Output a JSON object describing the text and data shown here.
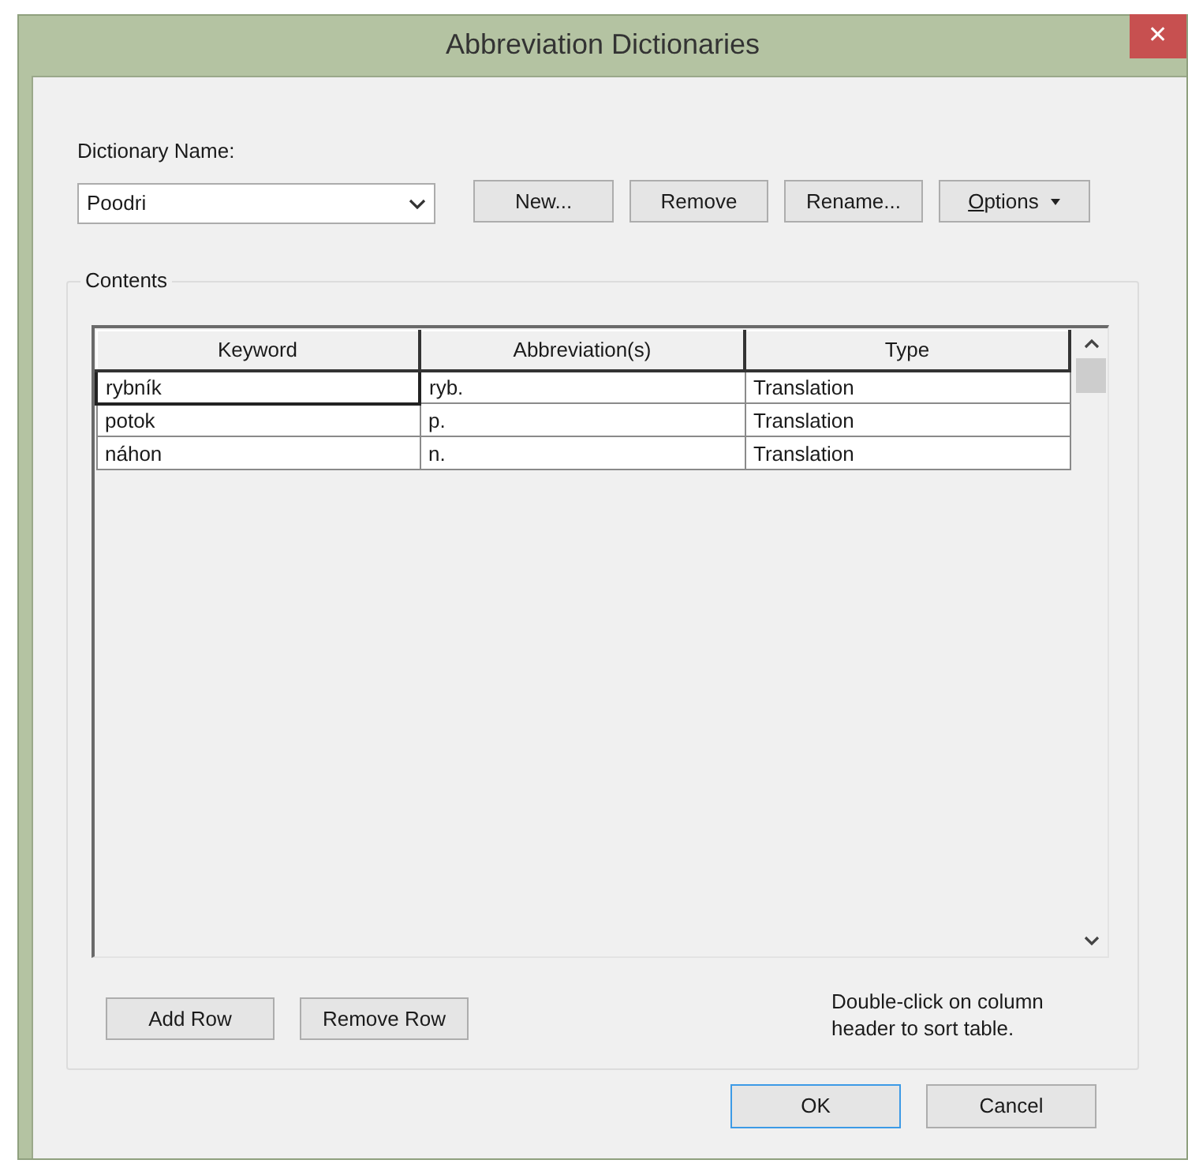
{
  "window": {
    "title": "Abbreviation Dictionaries",
    "close": "✕"
  },
  "dictionary": {
    "label": "Dictionary Name:",
    "value": "Poodri"
  },
  "dictionary_buttons": [
    {
      "label": "New...",
      "first_letter_underlined": false,
      "has_menu": false
    },
    {
      "label": "Remove",
      "first_letter_underlined": false,
      "has_menu": false
    },
    {
      "label": "Rename...",
      "first_letter_underlined": false,
      "has_menu": false
    },
    {
      "label": "Options",
      "first_letter_underlined": true,
      "has_menu": true
    }
  ],
  "contents": {
    "title": "Contents",
    "table": {
      "columns": [
        "Keyword",
        "Abbreviation(s)",
        "Type"
      ],
      "rows": [
        {
          "keyword": "rybník",
          "abbreviation": "ryb.",
          "type": "Translation",
          "selected": true
        },
        {
          "keyword": "potok",
          "abbreviation": "p.",
          "type": "Translation",
          "selected": false
        },
        {
          "keyword": "náhon",
          "abbreviation": "n.",
          "type": "Translation",
          "selected": false
        }
      ]
    },
    "row_buttons": [
      "Add Row",
      "Remove Row"
    ],
    "hint": "Double-click on column header to sort table."
  },
  "dialog_buttons": [
    {
      "label": "OK",
      "default": true
    },
    {
      "label": "Cancel",
      "default": false
    }
  ]
}
